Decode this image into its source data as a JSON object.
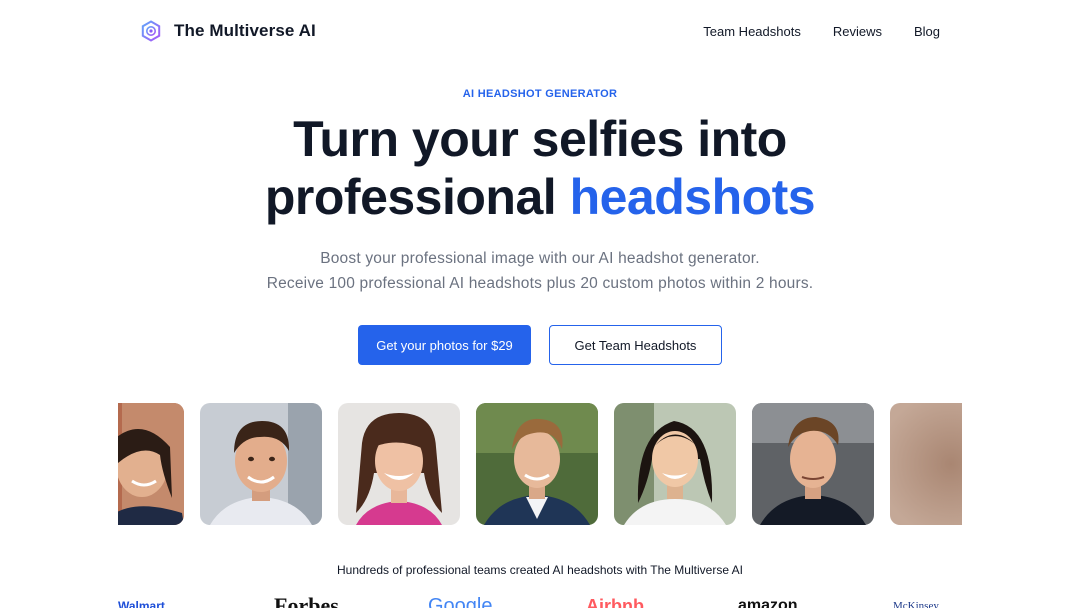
{
  "header": {
    "brand": "The Multiverse AI",
    "nav": [
      "Team Headshots",
      "Reviews",
      "Blog"
    ]
  },
  "hero": {
    "eyebrow": "AI HEADSHOT GENERATOR",
    "title_line1": "Turn your selfies into",
    "title_line2": "professional ",
    "title_accent": "headshots",
    "sub_line1": "Boost your professional image with our AI headshot generator.",
    "sub_line2": "Receive 100 professional AI headshots plus 20 custom photos within 2 hours."
  },
  "cta": {
    "primary": "Get your photos for $29",
    "secondary": "Get Team Headshots"
  },
  "trust": {
    "text": "Hundreds of professional teams created AI headshots with The Multiverse AI",
    "logos": [
      "Walmart",
      "Forbes",
      "Google",
      "Airbnb",
      "amazon",
      "McKinsey"
    ]
  },
  "colors": {
    "accent": "#2563eb",
    "text": "#111827",
    "muted": "#6b7280"
  }
}
